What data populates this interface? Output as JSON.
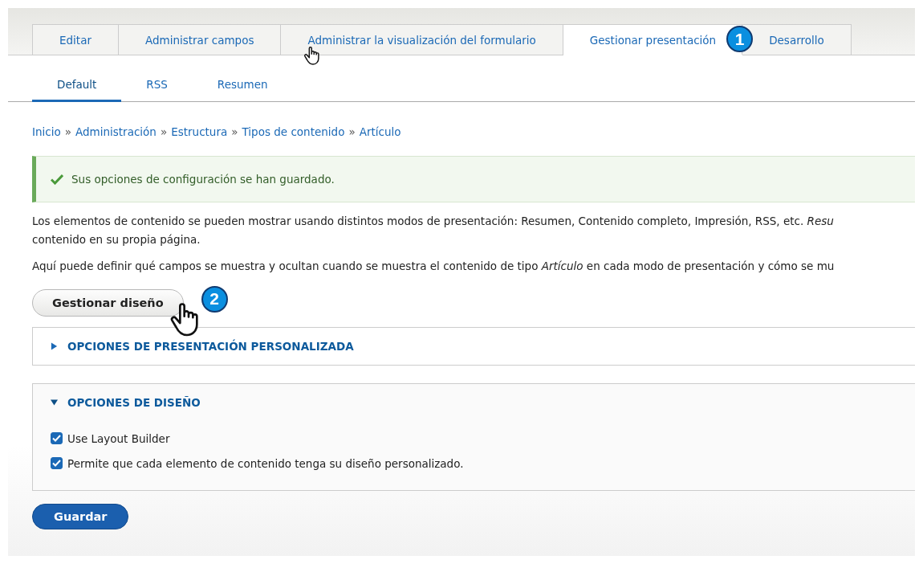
{
  "primary_tabs": [
    {
      "label": "Editar",
      "selected": false
    },
    {
      "label": "Administrar campos",
      "selected": false
    },
    {
      "label": "Administrar la visualización del formulario",
      "selected": false,
      "pointer": true
    },
    {
      "label": "Gestionar presentación",
      "selected": true,
      "step": "1"
    },
    {
      "label": "Desarrollo",
      "selected": false
    }
  ],
  "secondary_tabs": [
    {
      "label": "Default",
      "selected": true
    },
    {
      "label": "RSS",
      "selected": false
    },
    {
      "label": "Resumen",
      "selected": false
    }
  ],
  "breadcrumb": [
    "Inicio",
    "Administración",
    "Estructura",
    "Tipos de contenido",
    "Artículo"
  ],
  "breadcrumb_separator": "»",
  "status_message": "Sus opciones de configuración se han guardado.",
  "paragraphs": [
    "Los elementos de contenido se pueden mostrar usando distintos modos de presentación: Resumen, Contenido completo, Impresión, RSS, etc. *Resu*\ncontenido en su propia página.",
    "Aquí puede definir qué campos se muestra y ocultan cuando se muestra el contenido de tipo *Artículo* en cada modo de presentación y cómo se mu"
  ],
  "manage_button": {
    "label": "Gestionar diseño",
    "step": "2"
  },
  "sections": [
    {
      "title": "OPCIONES DE PRESENTACIÓN PERSONALIZADA",
      "expanded": false
    },
    {
      "title": "OPCIONES DE DISEÑO",
      "expanded": true,
      "options": [
        {
          "label": "Use Layout Builder",
          "checked": true
        },
        {
          "label": "Permite que cada elemento de contenido tenga su diseño personalizado.",
          "checked": true
        }
      ]
    }
  ],
  "save_button": "Guardar"
}
